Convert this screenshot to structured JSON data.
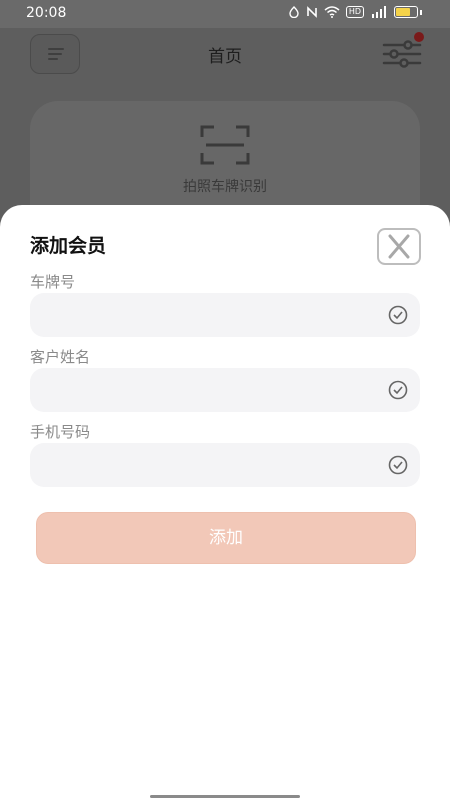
{
  "status_bar": {
    "time": "20:08"
  },
  "home": {
    "title": "首页",
    "scan_label": "拍照车牌识别"
  },
  "sheet": {
    "title": "添加会员",
    "fields": [
      {
        "label": "车牌号",
        "value": ""
      },
      {
        "label": "客户姓名",
        "value": ""
      },
      {
        "label": "手机号码",
        "value": ""
      }
    ],
    "submit_label": "添加"
  },
  "colors": {
    "accent_button": "#f2c8b8",
    "field_bg": "#f4f4f6",
    "overlay": "#5e5e5e"
  }
}
